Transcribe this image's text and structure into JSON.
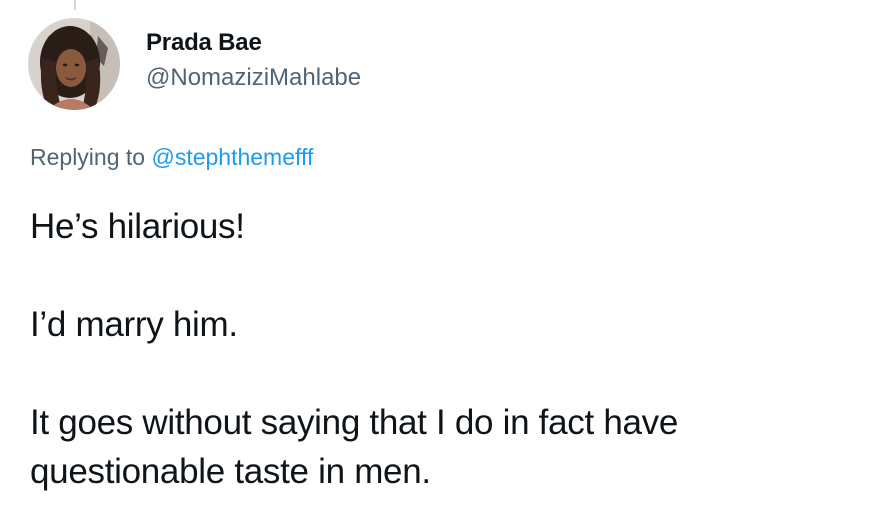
{
  "tweet": {
    "author": {
      "display_name": "Prada Bae",
      "handle": "@NomaziziMahlabe"
    },
    "reply": {
      "prefix": "Replying to ",
      "to_handle": "@stephthemefff"
    },
    "paragraphs": [
      "He’s hilarious!",
      "I’d marry him.",
      "It goes without saying that I do in fact have questionable taste in men."
    ]
  },
  "colors": {
    "text_primary": "#0f1419",
    "text_secondary": "#536471",
    "link": "#1d9bf0",
    "thread_line": "#cfd9de"
  }
}
